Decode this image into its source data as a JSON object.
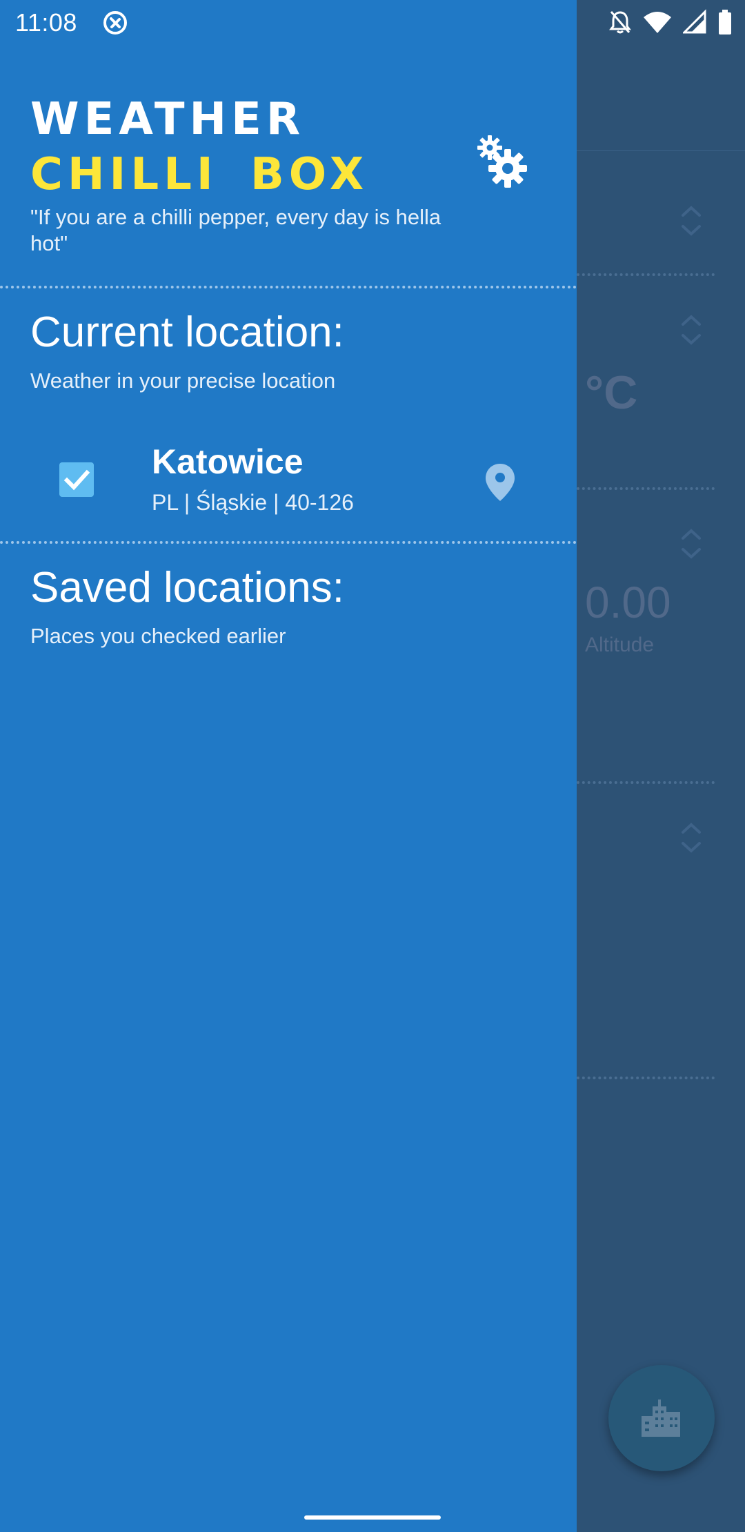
{
  "status_bar": {
    "time": "11:08"
  },
  "background": {
    "unit": "°C",
    "altitude_value": "0.00",
    "altitude_label": "Altitude"
  },
  "drawer": {
    "title_line1": "WEATHER",
    "title_line2": "CHILLI BOX",
    "tagline": "\"If you are a chilli pepper, every day is hella hot\"",
    "current": {
      "title": "Current location:",
      "subtitle": "Weather in your precise location",
      "location": {
        "name": "Katowice",
        "detail": "PL | Śląskie | 40-126",
        "checked": true
      }
    },
    "saved": {
      "title": "Saved locations:",
      "subtitle": "Places you checked earlier"
    }
  },
  "colors": {
    "drawer_bg": "#2079c6",
    "title_accent": "#fde63a",
    "checkbox": "#5fbcf1",
    "scrim_bg": "#2d5275"
  },
  "icons": [
    "app-status-icon",
    "bell-off-icon",
    "wifi-icon",
    "cell-signal-icon",
    "battery-icon",
    "settings-gears-icon",
    "check-icon",
    "location-pin-icon",
    "chevron-updown-icon",
    "city-icon"
  ]
}
